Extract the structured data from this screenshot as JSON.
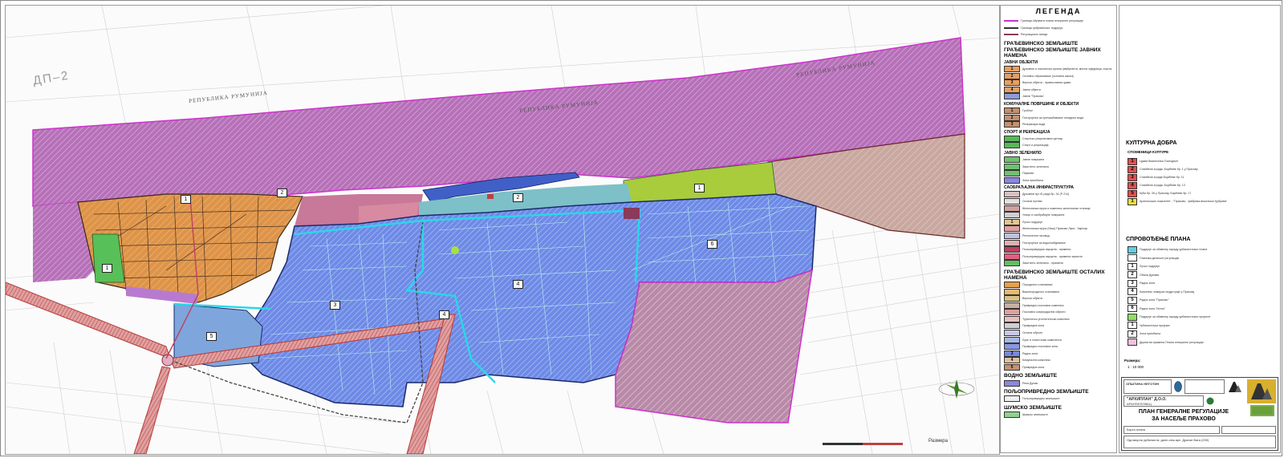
{
  "map": {
    "dp_label": "ДП–2",
    "river_label_1": "РЕПУБЛИКА РУМУНИЈА",
    "river_label_2": "РЕПУБЛИКА РУМУНИЈА",
    "river_label_3": "РЕПУБЛИКА РУМУНИЈА",
    "scale_label": "Размера",
    "zone_numbers": [
      "1",
      "2",
      "3",
      "4",
      "5",
      "6",
      "1",
      "2",
      "4",
      "1"
    ],
    "colors": {
      "river": "#b866b8",
      "residential": "#e0984a",
      "industry": "#6f8ee8",
      "green": "#9ed048",
      "farmland": "#b98aa6",
      "boundary": "#cc33cc",
      "infrastructure": "#c25a5a"
    }
  },
  "legend": {
    "title": "ЛЕГЕНДА",
    "boundaries": [
      "Граница обухвата плана генералне регулације",
      "Граница грађевинског подручја",
      "Регулациона линија"
    ],
    "section_building_land": "ГРАЂЕВИНСКО ЗЕМЉИШТЕ",
    "section_public": "ГРАЂЕВИНСКО ЗЕМЉИШТЕ ЈАВНИХ НАМЕНА",
    "sub_public_objects": "ЈАВНИ ОБЈЕКТИ",
    "public_objects": [
      {
        "num": "1",
        "text": "Државни и општински органи (амбуланта, месна заједница, пошта, дом културе)",
        "color": "#e8a060"
      },
      {
        "num": "2",
        "text": "Основно образовање (основна школа)",
        "color": "#e8a060"
      },
      {
        "num": "3",
        "text": "Верски објекти - православна црква",
        "color": "#e8a060"
      },
      {
        "num": "4",
        "text": "Јавни објекти",
        "color": "#e8a060"
      },
      {
        "num": "",
        "text": "Јавни \"Прахово\"",
        "color": "#8f9bd6"
      }
    ],
    "sub_communal": "КОМУНАЛНЕ ПОВРШИНЕ И ОБЈЕКТИ",
    "communal": [
      {
        "num": "1",
        "text": "Гробље",
        "color": "#c49070"
      },
      {
        "num": "2",
        "text": "Постројење за пречишћавање отпадних вода",
        "color": "#c49070"
      },
      {
        "num": "3",
        "text": "Резервоари воде",
        "color": "#c49070"
      }
    ],
    "sub_sport": "СПОРТ И РЕКРЕАЦИЈА",
    "sport": [
      {
        "num": "",
        "text": "Спортско рекреативни центар",
        "color": "#58b858"
      },
      {
        "num": "",
        "text": "Спорт и рекреација",
        "color": "#58b858"
      }
    ],
    "sub_green": "ЈАВНО ЗЕЛЕНИЛО",
    "green": [
      {
        "num": "",
        "text": "Јавне површине",
        "color": "#70c070"
      },
      {
        "num": "",
        "text": "Заштитно зеленило",
        "color": "#70c070"
      },
      {
        "num": "",
        "text": "Паркови",
        "color": "#70c070"
      },
      {
        "num": "",
        "text": "Зона приобаља",
        "color": "#8888dd"
      }
    ],
    "sub_traffic": "САОБРАЋАЈНА ИНФРАСТРУКТУРА",
    "traffic": [
      {
        "num": "",
        "text": "Државни пут IБ реда бр. 34 (Р 214)",
        "color": "#d8c0c0"
      },
      {
        "num": "",
        "text": "Остали путеви",
        "color": "#e8e0e0"
      },
      {
        "num": "",
        "text": "Железничка пруга и комплекс железничке станице",
        "color": "#d0a0a0"
      },
      {
        "num": "",
        "text": "Улице и саобраћајне површине",
        "color": "#d0d0d0"
      },
      {
        "num": "1",
        "text": "Лучко подручје",
        "color": "#e0c890"
      },
      {
        "num": "",
        "text": "Железничка пруга (Ниш) Прахово Лука - Зајечар",
        "color": "#e0a0a0"
      },
      {
        "num": "",
        "text": "Регионални гасовод",
        "color": "#c0c0e0"
      },
      {
        "num": "",
        "text": "Постројење за водоснабдевање",
        "color": "#e0b0b0"
      },
      {
        "num": "",
        "text": "Пољопривредна парцела - примена",
        "color": "#c04060"
      },
      {
        "num": "",
        "text": "Пољопривредна парцела - примена заштите",
        "color": "#e06080"
      },
      {
        "num": "",
        "text": "Заштитно зеленило - примена",
        "color": "#60c060"
      }
    ],
    "section_other": "ГРАЂЕВИНСКО ЗЕМЉИШТЕ ОСТАЛИХ НАМЕНА",
    "other": [
      {
        "num": "",
        "text": "Породично становање",
        "color": "#e8a050"
      },
      {
        "num": "",
        "text": "Вишепородично становање",
        "color": "#e8b870"
      },
      {
        "num": "",
        "text": "Верски објекти",
        "color": "#d8c088"
      },
      {
        "num": "",
        "text": "Привредно пословни комплекс",
        "color": "#c8b0a0"
      },
      {
        "num": "",
        "text": "Пословно комерцијални објекти",
        "color": "#e0a0a0"
      },
      {
        "num": "",
        "text": "Туристичко угоститељски комплекс",
        "color": "#e8c0c0"
      },
      {
        "num": "",
        "text": "Привредна зона",
        "color": "#d0d0d0"
      },
      {
        "num": "",
        "text": "Остали објекти",
        "color": "#c8c8e8"
      },
      {
        "num": "",
        "text": "Луке и логистички комплекси",
        "color": "#a8b8e8"
      },
      {
        "num": "",
        "text": "Привредно пословна зона",
        "color": "#8898e0"
      },
      {
        "num": "3",
        "text": "Радна зона",
        "color": "#7888e0"
      },
      {
        "num": "4",
        "text": "Комунални комплекс",
        "color": "#e0c0a0"
      },
      {
        "num": "5",
        "text": "Привредна зона",
        "color": "#c89070"
      }
    ],
    "other_tail": "Привредна зона",
    "section_water": "ВОДНО ЗЕМЉИШТЕ",
    "water": [
      {
        "num": "",
        "text": "Река Дунав",
        "color": "#8888e0"
      }
    ],
    "section_agri": "ПОЉОПРИВРЕДНО ЗЕМЉИШТЕ",
    "agri": [
      {
        "num": "",
        "text": "Пољопривредно земљиште",
        "color": "#f0f0f0"
      }
    ],
    "section_forest": "ШУМСКО ЗЕМЉИШТЕ",
    "forest": [
      {
        "num": "",
        "text": "Шумско земљиште",
        "color": "#90d090"
      }
    ]
  },
  "right_panel": {
    "heritage_title": "КУЛТУРНА ДОБРА",
    "heritage_sub": "СПОМЕНИЦИ КУЛТУРЕ",
    "heritage": [
      {
        "num": "1",
        "text": "Црква Вазнесења Господњег",
        "color": "#e05050"
      },
      {
        "num": "2",
        "text": "Стамбена зграда, Бојићеве бр. 1 у Прахову",
        "color": "#e05050"
      },
      {
        "num": "3",
        "text": "Стамбена зграда Бојићеве бр. 11",
        "color": "#e05050"
      },
      {
        "num": "4",
        "text": "Стамбена зграда, Бојићеве бр. 13",
        "color": "#e05050"
      },
      {
        "num": "5",
        "text": "Кућа бр. 26 у Прахову, Бојићеве бр. 17",
        "color": "#e05050"
      },
      {
        "num": "1",
        "text": "Археолошки локалитет - \"Прахово - фабрика вештачког ђубрива\"",
        "color": "#e8e040"
      }
    ],
    "implementation_title": "СПРОВОЂЕЊЕ ПЛАНА",
    "implementation": [
      {
        "num": "",
        "text": "Подручје за обавезну израду урбанистичког плана",
        "color": "#60d0e0"
      },
      {
        "num": "",
        "text": "Планови детаљне регулације",
        "color": "#ffffff"
      },
      {
        "num": "1",
        "text": "Лучко подручје",
        "color": "#ffffff"
      },
      {
        "num": "2",
        "text": "Обала Дунава",
        "color": "#ffffff"
      },
      {
        "num": "3",
        "text": "Радна зона",
        "color": "#ffffff"
      },
      {
        "num": "4",
        "text": "Комплекс хемијске индустрије у Прахову",
        "color": "#ffffff"
      },
      {
        "num": "5",
        "text": "Радна зона \"Прахово\"",
        "color": "#ffffff"
      },
      {
        "num": "6",
        "text": "Радна зона \"Исток\"",
        "color": "#ffffff"
      },
      {
        "num": "",
        "text": "Подручје за обавезну израду урбанистичког пројекта",
        "color": "#90e060"
      },
      {
        "num": "1",
        "text": "Урбанистички пројекат",
        "color": "#ffffff"
      },
      {
        "num": "2",
        "text": "Зона приобаља",
        "color": "#ffffff"
      },
      {
        "num": "",
        "text": "Директна примена Плана генералне регулације",
        "color": "#f0c0e0"
      }
    ],
    "scale_title": "Размера:",
    "scale_value": "1 : 10 000",
    "title_block": {
      "municipality": "ОПШТИНА НЕГОТИН",
      "company": "\"АРХИПЛАН\" Д.О.О.",
      "company_city": "АРАНЂЕЛОВАЦ",
      "plan_title_1": "ПЛАН ГЕНЕРАЛНЕ РЕГУЛАЦИЈЕ",
      "plan_title_2": "ЗА НАСЕЉЕ ПРАХОВО",
      "sheet_name": "Карта плана",
      "planner": "Одговорни урбаниста: дипл.инж.арх. Драган Вага (200)"
    }
  }
}
